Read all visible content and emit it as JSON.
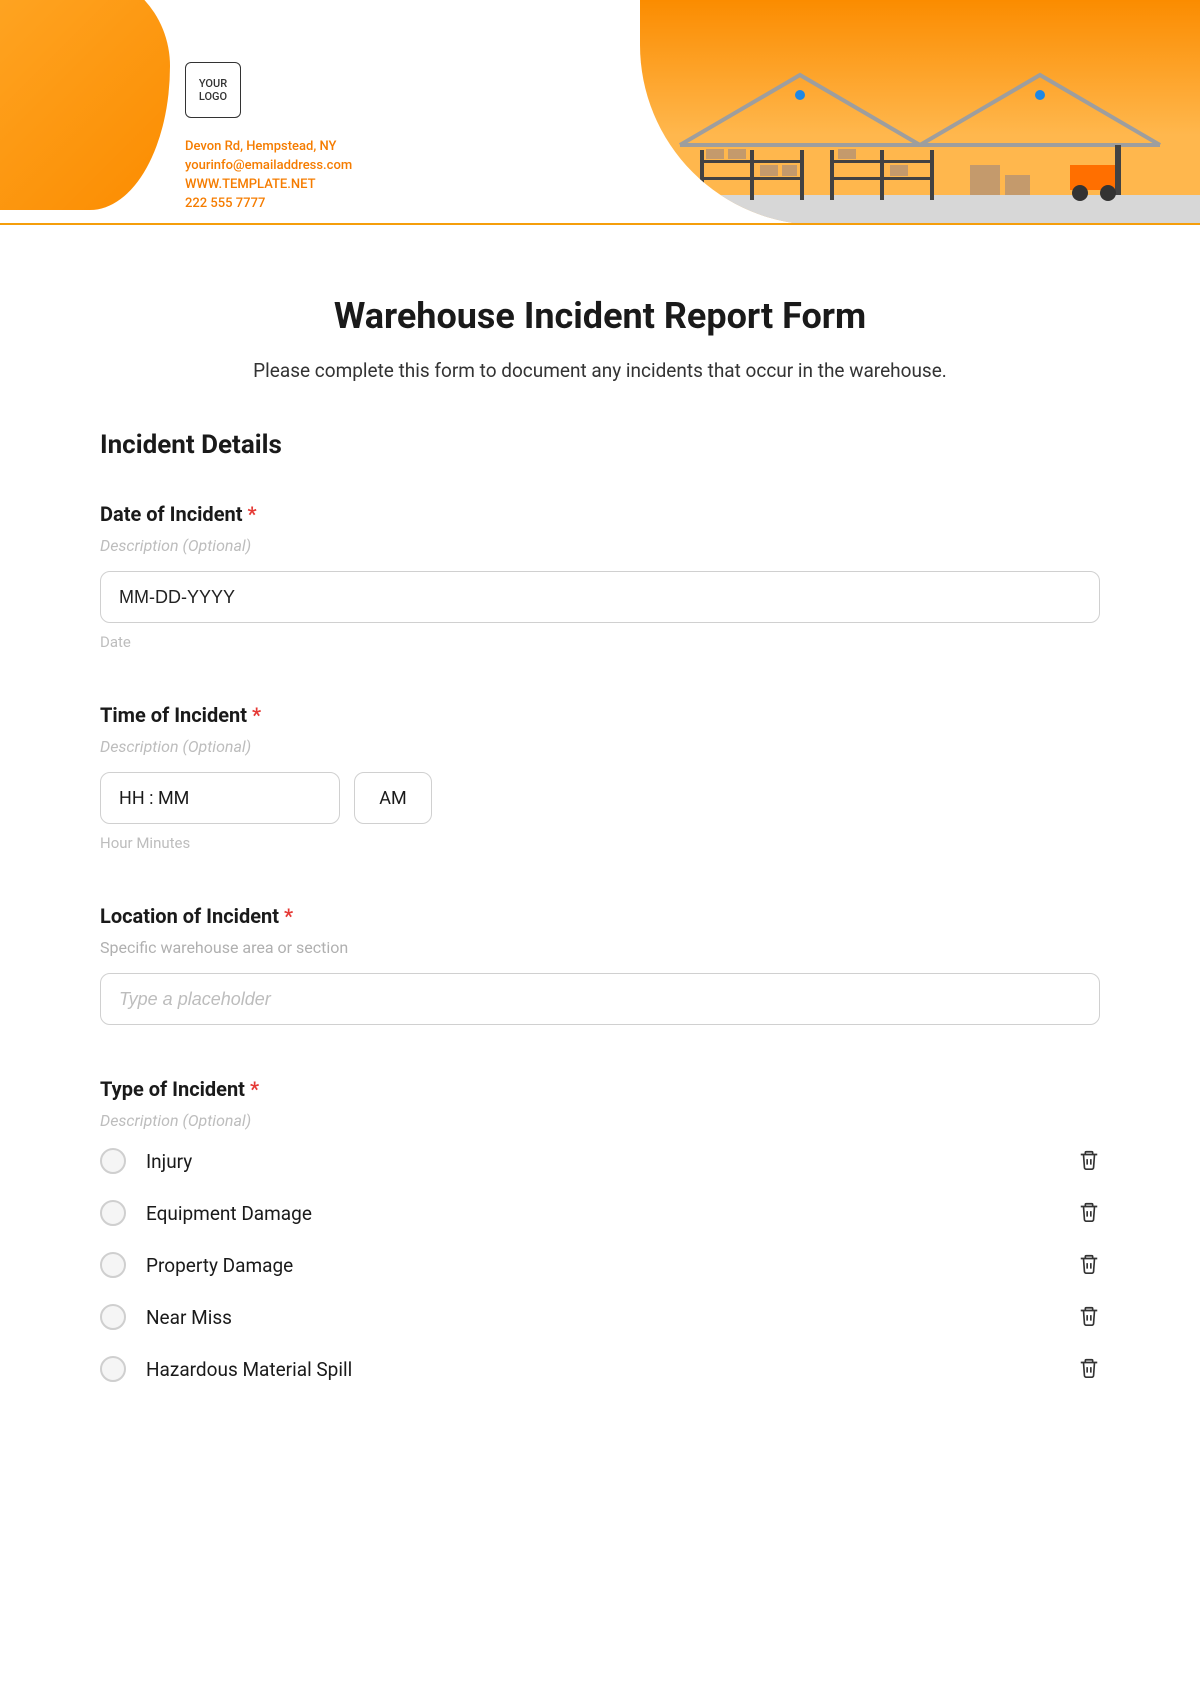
{
  "header": {
    "logo_text": "YOUR LOGO",
    "contact": {
      "address": "Devon Rd, Hempstead, NY",
      "email": "yourinfo@emailaddress.com",
      "website": "WWW.TEMPLATE.NET",
      "phone": "222 555 7777"
    }
  },
  "form": {
    "title": "Warehouse Incident Report Form",
    "subtitle": "Please complete this form to document any incidents that occur in the warehouse.",
    "section_title": "Incident Details",
    "required_mark": "*",
    "fields": {
      "date": {
        "label": "Date of Incident",
        "desc": "Description (Optional)",
        "value": "MM-DD-YYYY",
        "hint": "Date"
      },
      "time": {
        "label": "Time of Incident",
        "desc": "Description (Optional)",
        "value": "HH : MM",
        "ampm": "AM",
        "hint": "Hour Minutes"
      },
      "location": {
        "label": "Location of Incident",
        "desc": "Specific warehouse area or section",
        "placeholder": "Type a placeholder"
      },
      "type": {
        "label": "Type of Incident",
        "desc": "Description (Optional)",
        "options": [
          "Injury",
          "Equipment Damage",
          "Property Damage",
          "Near Miss",
          "Hazardous Material Spill"
        ]
      }
    }
  }
}
